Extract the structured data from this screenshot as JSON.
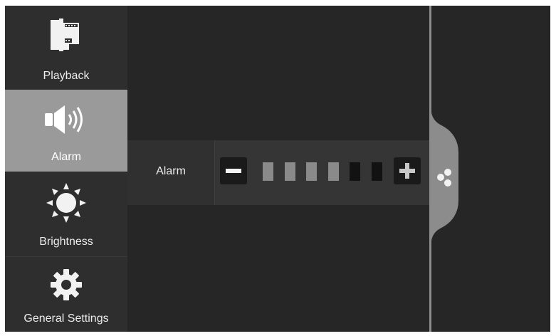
{
  "sidebar": {
    "items": [
      {
        "label": "Playback",
        "icon": "film-icon",
        "selected": false
      },
      {
        "label": "Alarm",
        "icon": "speaker-icon",
        "selected": true
      },
      {
        "label": "Brightness",
        "icon": "sun-icon",
        "selected": false
      },
      {
        "label": "General Settings",
        "icon": "gear-icon",
        "selected": false
      }
    ]
  },
  "main": {
    "setting": {
      "label": "Alarm",
      "level": 4,
      "max_level": 6
    }
  },
  "handle": {
    "icon": "share-dots-icon"
  },
  "colors": {
    "background": "#262626",
    "selected": "#9a9a9a",
    "level_on": "#8a8a8a",
    "level_off": "#121212"
  }
}
